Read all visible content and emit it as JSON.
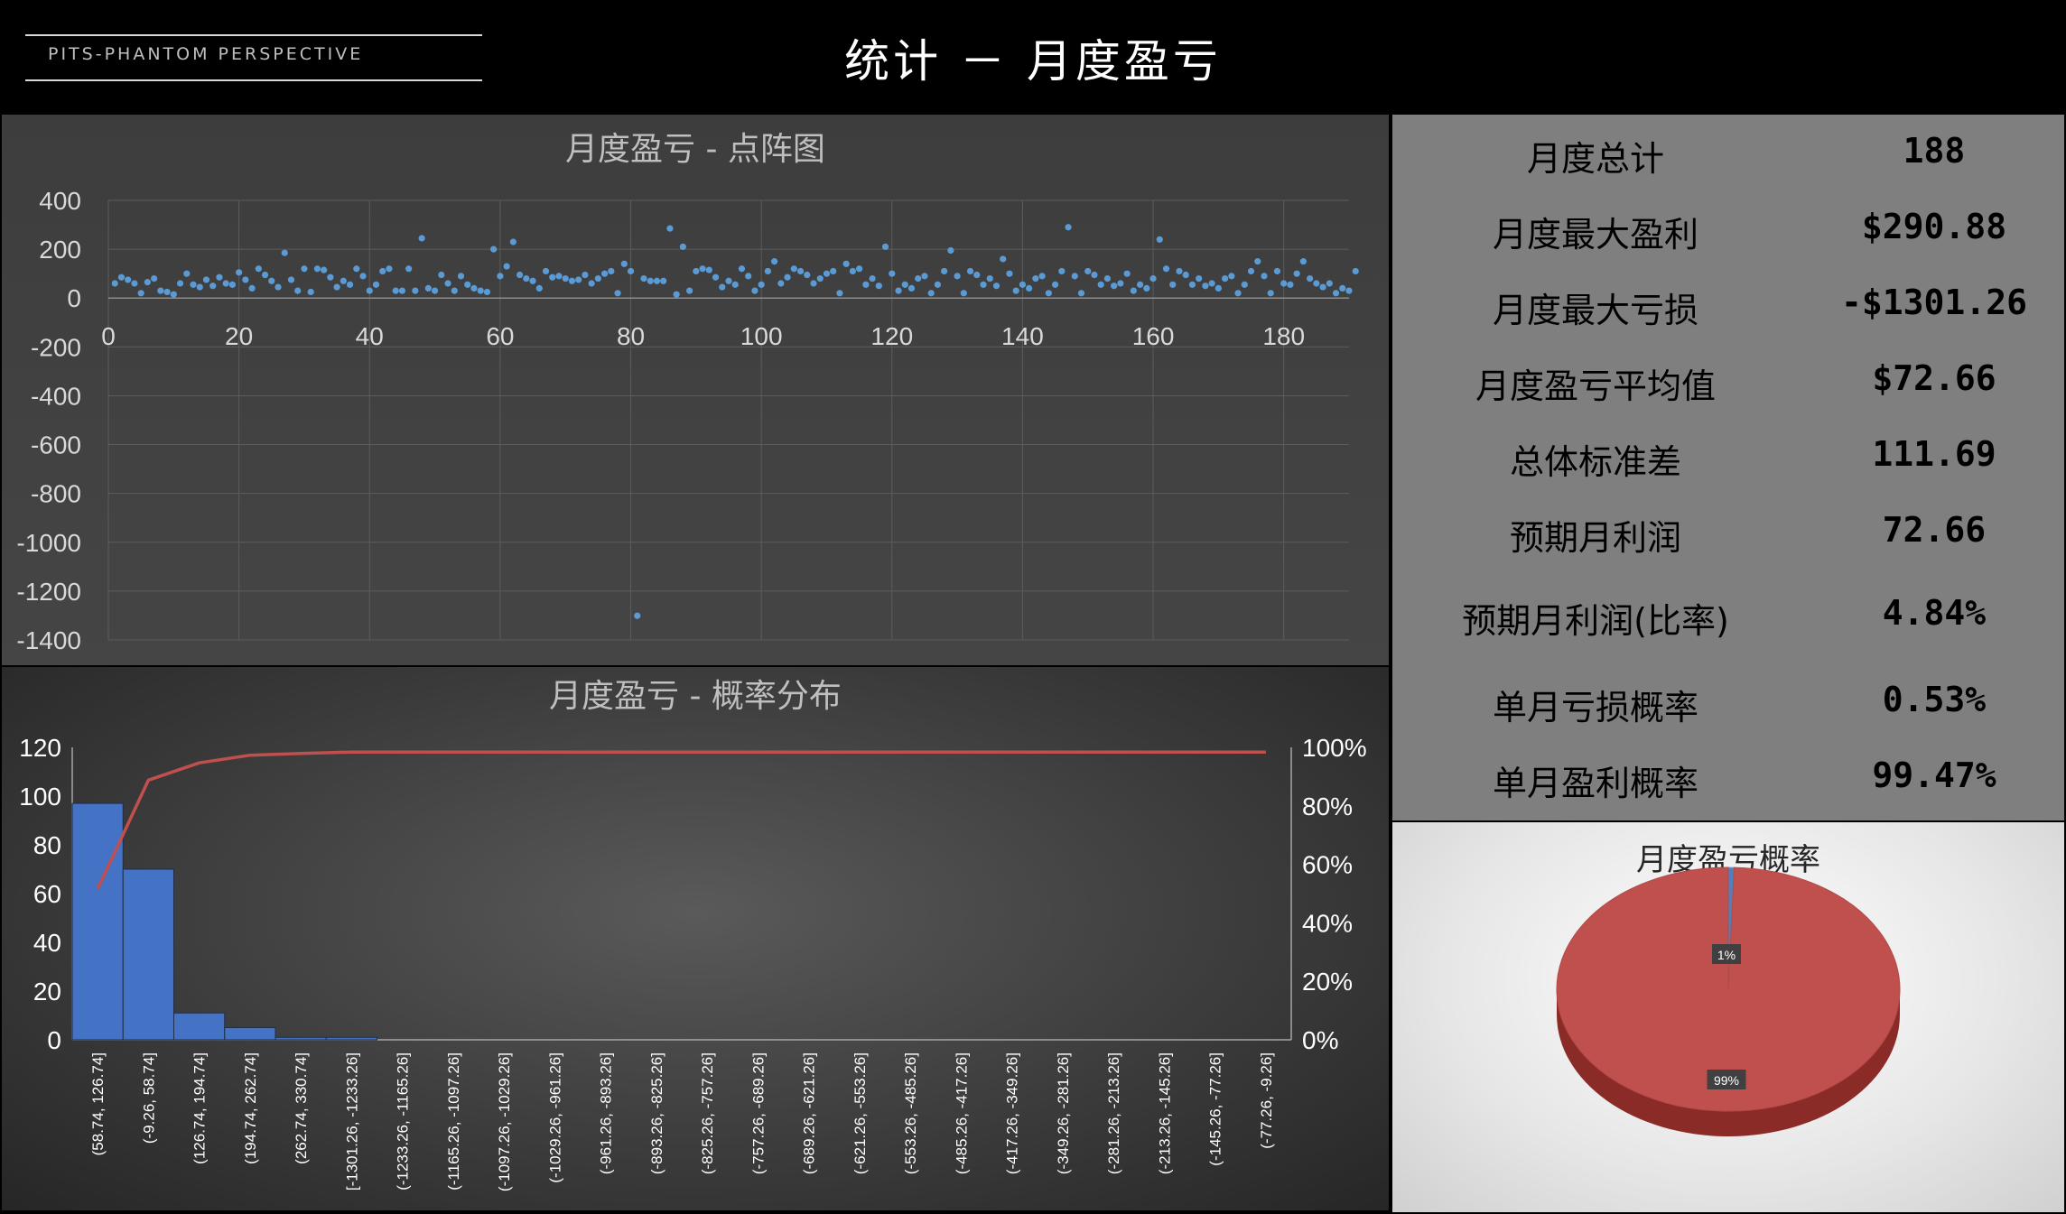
{
  "header": {
    "logo_text": "PITS-PHANTOM PERSPECTIVE",
    "title": "统计 － 月度盈亏"
  },
  "stats": [
    {
      "label": "月度总计",
      "value": "188"
    },
    {
      "label": "月度最大盈利",
      "value": "$290.88"
    },
    {
      "label": "月度最大亏损",
      "value": "-$1301.26"
    },
    {
      "label": "月度盈亏平均值",
      "value": "$72.66"
    },
    {
      "label": "总体标准差",
      "value": "111.69"
    },
    {
      "label": "预期月利润",
      "value": "72.66"
    },
    {
      "label": "预期月利润(比率)",
      "value": "4.84%"
    },
    {
      "label": "单月亏损概率",
      "value": "0.53%"
    },
    {
      "label": "单月盈利概率",
      "value": "99.47%"
    }
  ],
  "colors": {
    "scatter_point": "#5b9bd5",
    "bar_fill": "#4472c4",
    "cumulative_line": "#c0504d",
    "pie_profit": "#c0504d",
    "pie_loss": "#4f81bd"
  },
  "chart_data": [
    {
      "type": "scatter",
      "title": "月度盈亏 - 点阵图",
      "xlim": [
        0,
        190
      ],
      "ylim": [
        -1400,
        400
      ],
      "x_ticks": [
        "0",
        "20",
        "40",
        "60",
        "80",
        "100",
        "120",
        "140",
        "160",
        "180"
      ],
      "y_ticks": [
        "400",
        "200",
        "0",
        "-200",
        "-400",
        "-600",
        "-800",
        "-1000",
        "-1200",
        "-1400"
      ],
      "y": [
        60,
        85,
        75,
        60,
        20,
        65,
        80,
        30,
        25,
        15,
        60,
        100,
        55,
        45,
        75,
        50,
        85,
        60,
        55,
        105,
        75,
        40,
        120,
        95,
        70,
        45,
        185,
        75,
        30,
        120,
        25,
        120,
        115,
        85,
        45,
        70,
        55,
        120,
        90,
        30,
        55,
        110,
        120,
        30,
        30,
        120,
        30,
        245,
        40,
        30,
        95,
        60,
        30,
        90,
        55,
        40,
        30,
        25,
        200,
        90,
        130,
        230,
        95,
        80,
        70,
        40,
        110,
        85,
        90,
        80,
        70,
        75,
        95,
        60,
        80,
        100,
        110,
        20,
        140,
        110,
        -1301,
        80,
        70,
        70,
        70,
        285,
        15,
        210,
        30,
        110,
        120,
        115,
        85,
        45,
        70,
        55,
        120,
        90,
        30,
        55,
        110,
        150,
        60,
        85,
        120,
        110,
        95,
        60,
        80,
        100,
        110,
        20,
        140,
        110,
        120,
        55,
        80,
        50,
        210,
        100,
        30,
        55,
        40,
        80,
        90,
        20,
        55,
        110,
        195,
        90,
        20,
        110,
        95,
        55,
        80,
        50,
        160,
        100,
        30,
        55,
        40,
        80,
        90,
        20,
        55,
        110,
        290,
        90,
        20,
        110,
        95,
        55,
        80,
        50,
        60,
        100,
        30,
        55,
        40,
        80,
        240,
        120,
        55,
        110,
        95,
        55,
        80,
        50,
        60,
        40,
        80,
        90,
        20,
        55,
        110,
        150,
        90,
        20,
        110,
        60,
        55,
        100,
        150,
        80,
        60,
        45,
        60,
        20,
        40,
        30,
        110
      ]
    },
    {
      "type": "bar",
      "title": "月度盈亏 - 概率分布",
      "categories": [
        "(58.74, 126.74]",
        "(-9.26, 58.74]",
        "(126.74, 194.74]",
        "(194.74, 262.74]",
        "(262.74, 330.74]",
        "[-1301.26, -1233.26]",
        "(-1233.26, -1165.26]",
        "(-1165.26, -1097.26]",
        "(-1097.26, -1029.26]",
        "(-1029.26, -961.26]",
        "(-961.26, -893.26]",
        "(-893.26, -825.26]",
        "(-825.26, -757.26]",
        "(-757.26, -689.26]",
        "(-689.26, -621.26]",
        "(-621.26, -553.26]",
        "(-553.26, -485.26]",
        "(-485.26, -417.26]",
        "(-417.26, -349.26]",
        "(-349.26, -281.26]",
        "(-281.26, -213.26]",
        "(-213.26, -145.26]",
        "(-145.26, -77.26]",
        "(-77.26, -9.26]"
      ],
      "values": [
        97,
        70,
        11,
        5,
        1,
        1,
        0,
        0,
        0,
        0,
        0,
        0,
        0,
        0,
        0,
        0,
        0,
        0,
        0,
        0,
        0,
        0,
        0,
        0
      ],
      "cumulative_percent": [
        51.6,
        88.8,
        94.7,
        97.3,
        97.9,
        98.4,
        98.4,
        98.4,
        98.4,
        98.4,
        98.4,
        98.4,
        98.4,
        98.4,
        98.4,
        98.4,
        98.4,
        98.4,
        98.4,
        98.4,
        98.4,
        98.4,
        98.4,
        98.4
      ],
      "ylim": [
        0,
        120
      ],
      "y_ticks": [
        "120",
        "100",
        "80",
        "60",
        "40",
        "20",
        "0"
      ],
      "y2_ticks": [
        "100%",
        "80%",
        "60%",
        "40%",
        "20%",
        "0%"
      ]
    },
    {
      "type": "pie",
      "title": "月度盈亏概率",
      "slices": [
        {
          "label": "1%",
          "value": 0.53
        },
        {
          "label": "99%",
          "value": 99.47
        }
      ]
    }
  ]
}
